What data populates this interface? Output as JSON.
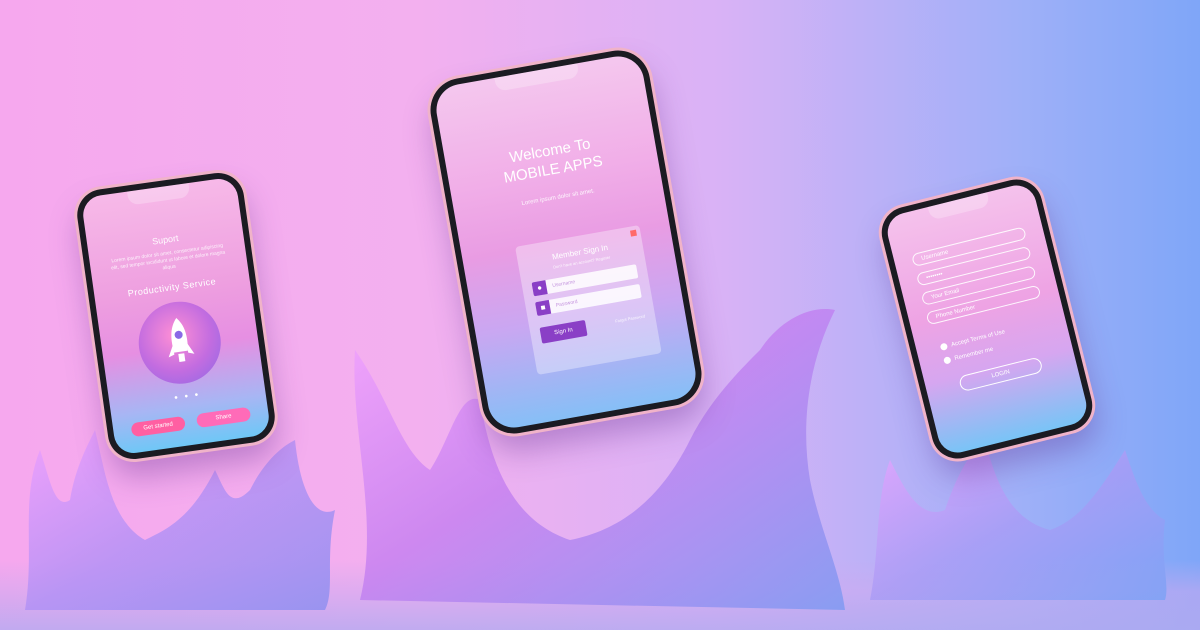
{
  "phone_left": {
    "title": "Suport",
    "paragraph": "Lorem ipsum dolor sit amet, consectetur adipiscing elit, sed tempor incididunt ut labore et dolore magna aliqua",
    "subtitle": "Productivity Service",
    "dots": "• • •",
    "button_left": "Get started",
    "button_right": "Share"
  },
  "phone_center": {
    "welcome_line1": "Welcome To",
    "welcome_line2": "MOBILE APPS",
    "tagline": "Lorem ipsum dolor sit amet.",
    "card_heading": "Member Sign In",
    "card_subheading": "Don't have an account?  Register",
    "username_placeholder": "Username",
    "password_placeholder": "Password",
    "sign_in_label": "Sign In",
    "remember_label": "Forgot Password"
  },
  "phone_right": {
    "username": "Username",
    "password": "••••••••",
    "email": "Your Email",
    "phone": "Phone Number",
    "check_terms": "Accept Terms of Use",
    "check_remember": "Remember me",
    "login_label": "LOGIN"
  },
  "icons": {
    "rocket": "rocket-icon",
    "user": "user-icon",
    "lock": "lock-icon",
    "check": "check-icon"
  },
  "colors": {
    "accent_purple": "#8a3fc6",
    "accent_pink": "#ff5fa2"
  }
}
